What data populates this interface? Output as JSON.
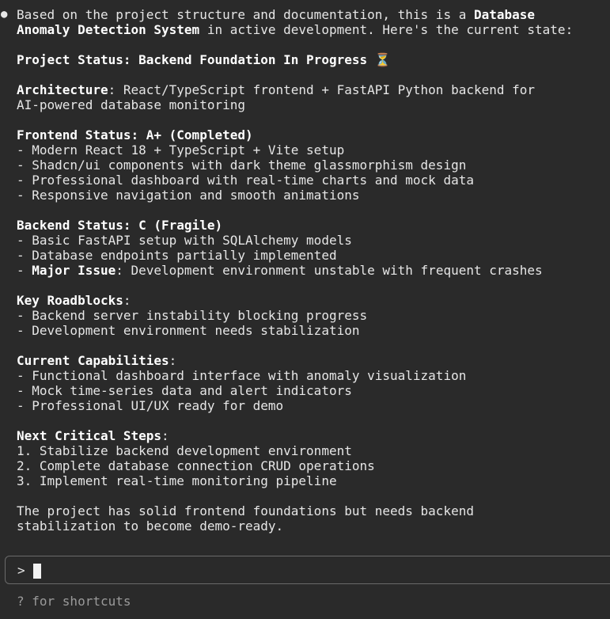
{
  "message": {
    "intro_a": "Based on the project structure and documentation, this is a ",
    "intro_b": "Database",
    "intro_c": "Anomaly Detection System",
    "intro_d": " in active development. Here's the current state:",
    "status_line": "Project Status: Backend Foundation In Progress ⏳",
    "arch_label": "Architecture",
    "arch_text": ": React/TypeScript frontend + FastAPI Python backend for",
    "arch_text2": "AI-powered database monitoring",
    "frontend_heading": "Frontend Status: A+ (Completed)",
    "frontend_items": [
      "- Modern React 18 + TypeScript + Vite setup",
      "- Shadcn/ui components with dark theme glassmorphism design",
      "- Professional dashboard with real-time charts and mock data",
      "- Responsive navigation and smooth animations"
    ],
    "backend_heading": "Backend Status: C (Fragile)",
    "backend_items": [
      "- Basic FastAPI setup with SQLAlchemy models",
      "- Database endpoints partially implemented"
    ],
    "backend_issue_prefix": "- ",
    "backend_issue_label": "Major Issue",
    "backend_issue_text": ": Development environment unstable with frequent crashes",
    "roadblocks_heading": "Key Roadblocks",
    "roadblocks_colon": ":",
    "roadblocks_items": [
      "- Backend server instability blocking progress",
      "- Development environment needs stabilization"
    ],
    "capabilities_heading": "Current Capabilities",
    "capabilities_colon": ":",
    "capabilities_items": [
      "- Functional dashboard interface with anomaly visualization",
      "- Mock time-series data and alert indicators",
      "- Professional UI/UX ready for demo"
    ],
    "next_heading": "Next Critical Steps",
    "next_colon": ":",
    "next_items": [
      "1. Stabilize backend development environment",
      "2. Complete database connection CRUD operations",
      "3. Implement real-time monitoring pipeline"
    ],
    "closing1": "The project has solid frontend foundations but needs backend",
    "closing2": "stabilization to become demo-ready."
  },
  "prompt": {
    "symbol": ">",
    "value": ""
  },
  "hint": "? for shortcuts"
}
